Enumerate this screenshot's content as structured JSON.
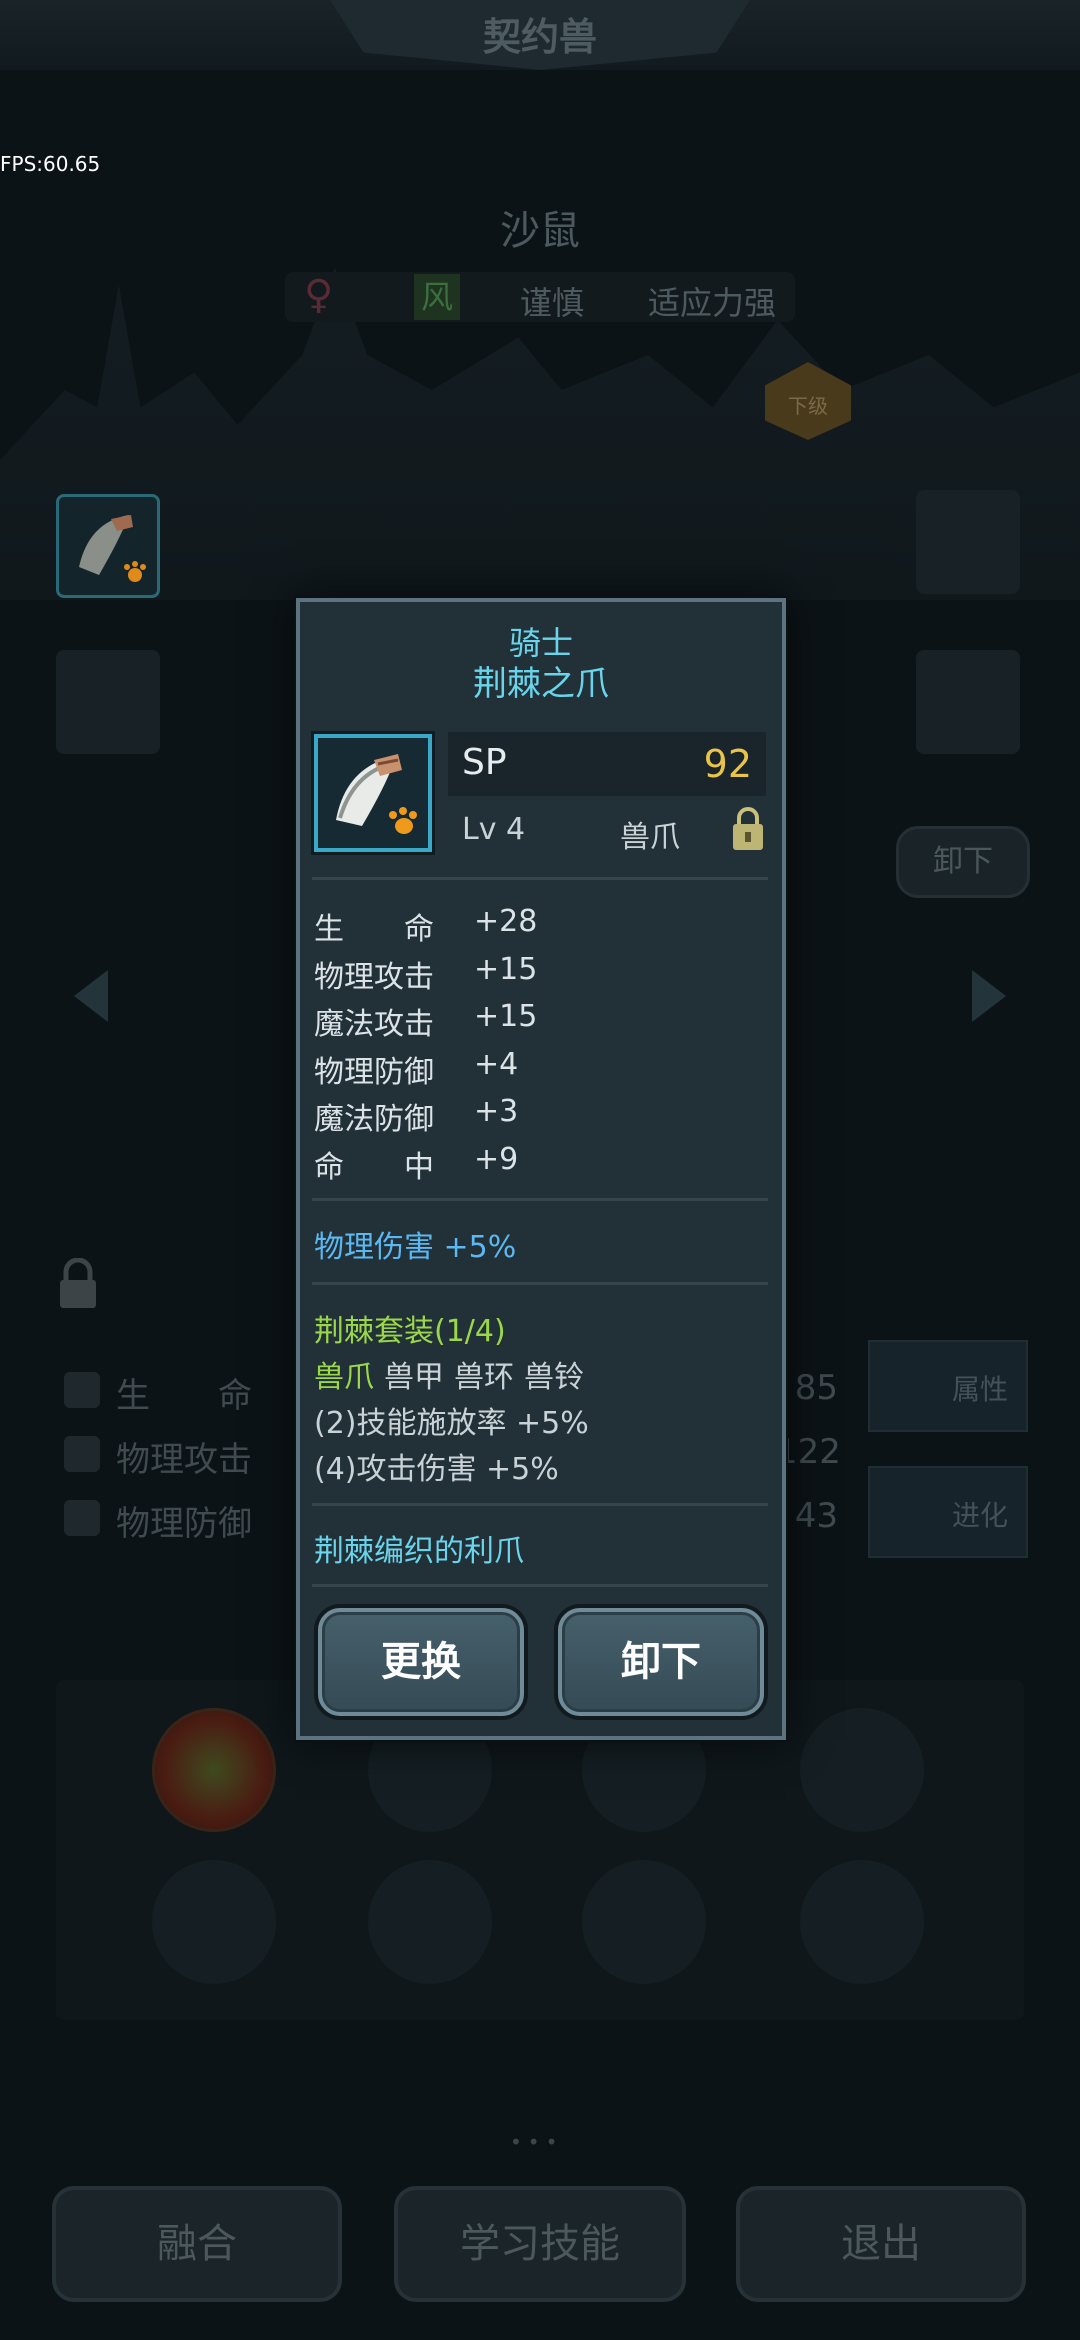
{
  "header": {
    "title": "契约兽"
  },
  "debug": {
    "fps": "FPS:60.65"
  },
  "beast": {
    "name": "沙鼠",
    "gender_symbol": "♀",
    "element": "风",
    "traits": [
      "谨慎",
      "适应力强"
    ],
    "downgrade_badge": "下级"
  },
  "background": {
    "unequip_label": "卸下",
    "stats": [
      {
        "label": "生　　命",
        "value": "85"
      },
      {
        "label": "物理攻击",
        "value": "122"
      },
      {
        "label": "物理防御",
        "value": "43"
      }
    ],
    "side_buttons": [
      "属性",
      "进化"
    ],
    "bottom_buttons": [
      "融合",
      "学习技能",
      "退出"
    ]
  },
  "popup": {
    "quality": "骑士",
    "name": "荆棘之爪",
    "icon": "beast-claw-icon",
    "sp_label": "SP",
    "sp_value": "92",
    "level": "Lv 4",
    "slot_type": "兽爪",
    "stats": [
      {
        "label": "生　　命",
        "value": "+28"
      },
      {
        "label": "物理攻击",
        "value": "+15"
      },
      {
        "label": "魔法攻击",
        "value": "+15"
      },
      {
        "label": "物理防御",
        "value": "+4"
      },
      {
        "label": "魔法防御",
        "value": "+3"
      },
      {
        "label": "命　　中",
        "value": "+9"
      }
    ],
    "bonus": "物理伤害 +5%",
    "set": {
      "title": "荆棘套装(1/4)",
      "pieces": [
        {
          "name": "兽爪",
          "owned": true
        },
        {
          "name": "兽甲",
          "owned": false
        },
        {
          "name": "兽环",
          "owned": false
        },
        {
          "name": "兽铃",
          "owned": false
        }
      ],
      "effects": [
        "(2)技能施放率 +5%",
        "(4)攻击伤害 +5%"
      ]
    },
    "description": "荆棘编织的利爪",
    "buttons": {
      "replace": "更换",
      "unequip": "卸下"
    }
  },
  "colors": {
    "quality_cyan": "#6ad4ea",
    "sp_gold": "#e8c44a",
    "bonus_blue": "#5cb8f0",
    "set_green": "#9ad84a"
  }
}
